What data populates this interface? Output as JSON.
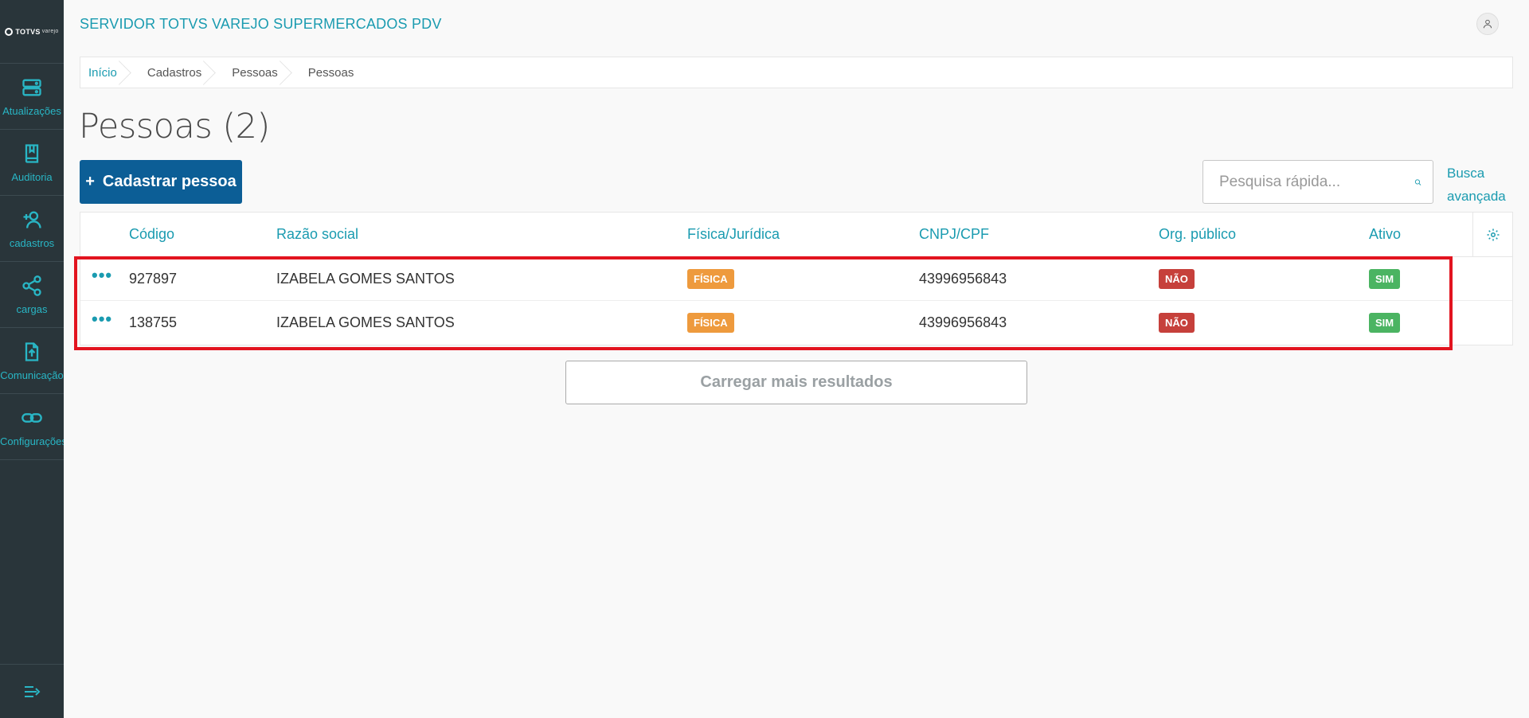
{
  "app": {
    "logo_text": "TOTVS",
    "logo_sub": "varejo",
    "server_title": "SERVIDOR TOTVS VAREJO SUPERMERCADOS PDV"
  },
  "sidebar": {
    "items": [
      {
        "label": "Atualizações",
        "icon": "server-icon"
      },
      {
        "label": "Auditoria",
        "icon": "book-icon"
      },
      {
        "label": "cadastros",
        "icon": "user-plus-icon"
      },
      {
        "label": "cargas",
        "icon": "share-icon"
      },
      {
        "label": "Comunicação",
        "icon": "upload-file-icon"
      },
      {
        "label": "Configurações",
        "icon": "link-icon"
      }
    ]
  },
  "breadcrumb": [
    "Início",
    "Cadastros",
    "Pessoas",
    "Pessoas"
  ],
  "page": {
    "title": "Pessoas (2)",
    "add_button": "Cadastrar pessoa",
    "search_placeholder": "Pesquisa rápida...",
    "advanced_search_line1": "Busca",
    "advanced_search_line2": "avançada",
    "load_more": "Carregar mais resultados"
  },
  "table": {
    "columns": [
      "Código",
      "Razão social",
      "Física/Jurídica",
      "CNPJ/CPF",
      "Org. público",
      "Ativo"
    ],
    "rows": [
      {
        "codigo": "927897",
        "razao_social": "IZABELA GOMES SANTOS",
        "tipo": "FÍSICA",
        "cnpj_cpf": "43996956843",
        "org_publico": "NÃO",
        "ativo": "SIM"
      },
      {
        "codigo": "138755",
        "razao_social": "IZABELA GOMES SANTOS",
        "tipo": "FÍSICA",
        "cnpj_cpf": "43996956843",
        "org_publico": "NÃO",
        "ativo": "SIM"
      }
    ]
  },
  "colors": {
    "accent": "#1a9bb0",
    "primary_button": "#0c5e96",
    "sidebar_bg": "#29353a",
    "tag_fisica": "#ee9a3d",
    "tag_nao": "#c6403b",
    "tag_sim": "#4bb462",
    "highlight_border": "#e2141f"
  }
}
